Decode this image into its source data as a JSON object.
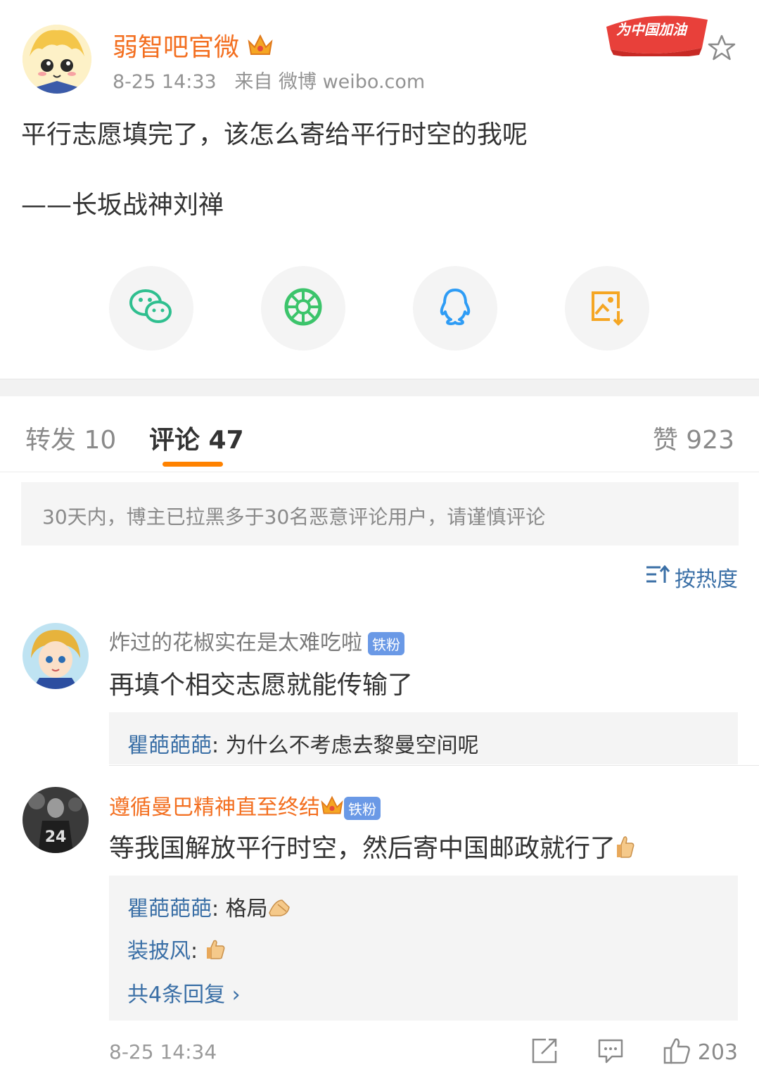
{
  "post": {
    "author": "弱智吧官微",
    "meta": "8-25 14:33   来自 微博 weibo.com",
    "line1": "平行志愿填完了，该怎么寄给平行时空的我呢",
    "line2": "——长坂战神刘禅",
    "banner_text": "为中国加油",
    "favorite_icon": "star-outline-icon"
  },
  "share": [
    {
      "name": "wechat",
      "icon": "wechat-icon",
      "color": "#2fbf8f"
    },
    {
      "name": "moments",
      "icon": "moments-icon",
      "color": "#3cc46b"
    },
    {
      "name": "qq",
      "icon": "qq-icon",
      "color": "#2e9cf5"
    },
    {
      "name": "save-image",
      "icon": "save-image-icon",
      "color": "#f5a623"
    }
  ],
  "tabs": {
    "repost": "转发 10",
    "comments": "评论 47",
    "likes": "赞 923",
    "accent": "#ff8200"
  },
  "notice": "30天内，博主已拉黑多于30名恶意评论用户，请谨慎评论",
  "sort_label": "按热度",
  "comments": [
    {
      "user": "炸过的花椒实在是太难吃啦",
      "badge": "铁粉",
      "text": "再填个相交志愿就能传输了",
      "replies": [
        {
          "user": "瞿葩葩葩",
          "text": ": 为什么不考虑去黎曼空间呢"
        }
      ]
    },
    {
      "user": "遵循曼巴精神直至终结",
      "badge": "铁粉",
      "text": "等我国解放平行时空，然后寄中国邮政就行了",
      "replies": [
        {
          "user": "瞿葩葩葩",
          "text": ": 格局"
        },
        {
          "user": "装披风",
          "text": ": "
        }
      ],
      "more": "共4条回复 ›",
      "time": "8-25 14:34",
      "likes": "203"
    }
  ]
}
